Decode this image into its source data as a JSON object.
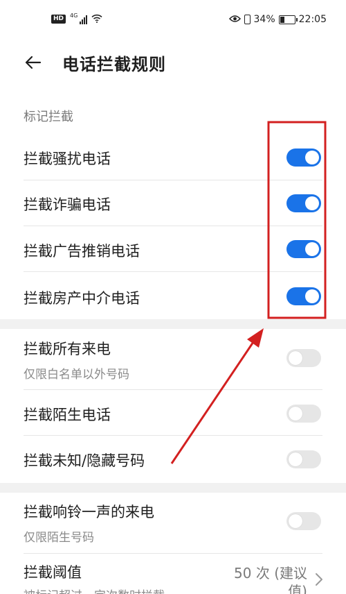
{
  "status_bar": {
    "hd": "HD",
    "network": "4G",
    "battery_percent": "34%",
    "battery_level": 0.34,
    "time": "22:05",
    "icons": [
      "signal-icon",
      "wifi-icon",
      "eye-icon",
      "vibrate-icon",
      "battery-icon"
    ]
  },
  "header": {
    "title": "电话拦截规则",
    "back_icon": "back-arrow-icon"
  },
  "section_mark": {
    "label": "标记拦截",
    "items": [
      {
        "label": "拦截骚扰电话",
        "enabled": true
      },
      {
        "label": "拦截诈骗电话",
        "enabled": true
      },
      {
        "label": "拦截广告推销电话",
        "enabled": true
      },
      {
        "label": "拦截房产中介电话",
        "enabled": true
      }
    ]
  },
  "section_general": {
    "items": [
      {
        "label": "拦截所有来电",
        "sublabel": "仅限白名单以外号码",
        "enabled": false
      },
      {
        "label": "拦截陌生电话",
        "enabled": false
      },
      {
        "label": "拦截未知/隐藏号码",
        "enabled": false
      }
    ]
  },
  "section_ring": {
    "items": [
      {
        "label": "拦截响铃一声的来电",
        "sublabel": "仅限陌生号码",
        "enabled": false
      }
    ],
    "threshold": {
      "label": "拦截阈值",
      "sublabel": "被标记超过一定次数时拦截",
      "value": "50 次 (建议",
      "value_line2": "值)"
    }
  },
  "colors": {
    "toggle_on": "#1a73e8",
    "toggle_off": "#e6e6e6",
    "annotation": "#d32020"
  }
}
